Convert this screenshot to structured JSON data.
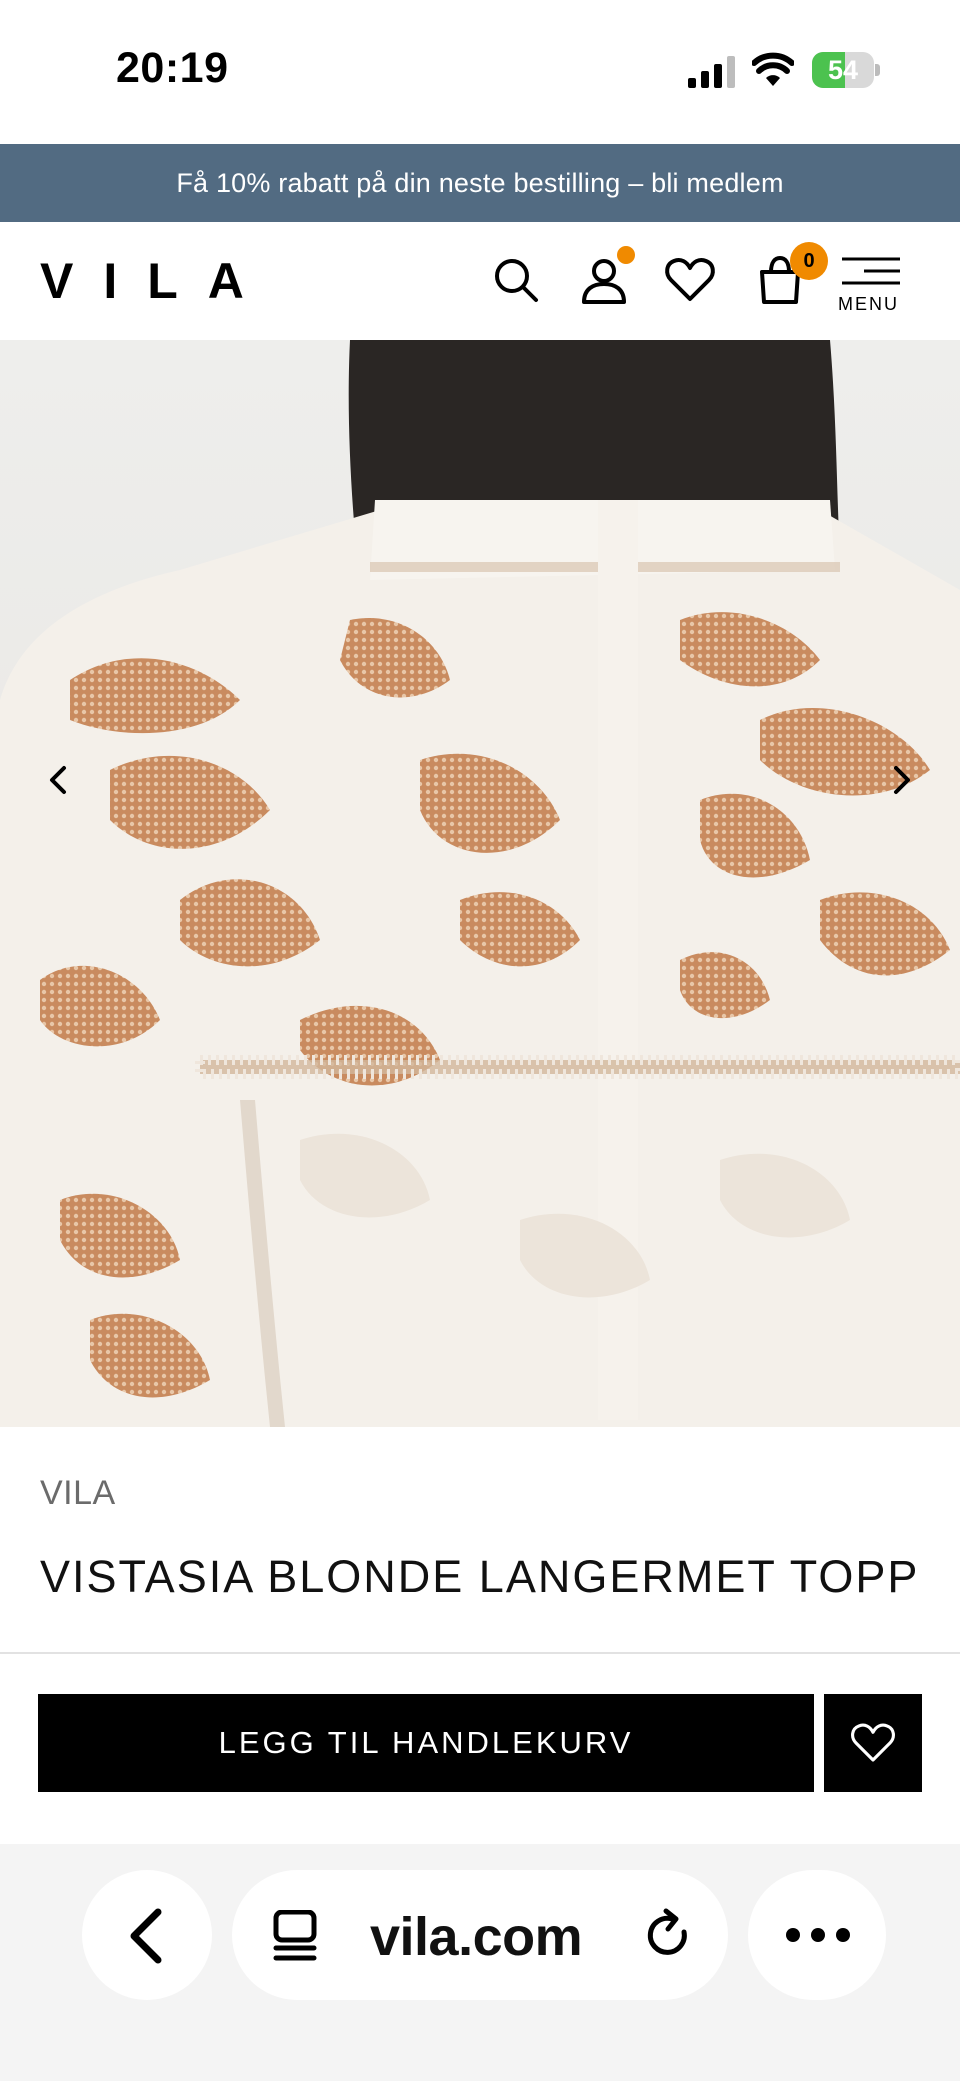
{
  "status_bar": {
    "time": "20:19",
    "battery_percent": "54",
    "battery_level": 0.54
  },
  "promo_banner": {
    "text": "Få 10% rabatt på din neste bestilling – bli medlem",
    "color": "#526b82"
  },
  "header": {
    "logo": "VILA",
    "cart_count": "0",
    "menu_label": "MENU",
    "badge_color": "#f08a00"
  },
  "product": {
    "brand": "VILA",
    "title": "VISTASIA BLONDE LANGERMET TOPP",
    "add_to_cart_label": "LEGG TIL HANDLEKURV"
  },
  "browser": {
    "url": "vila.com"
  },
  "icons": {
    "search": "search-icon",
    "account": "user-icon",
    "wishlist": "heart-icon",
    "cart": "bag-icon",
    "menu": "hamburger-icon",
    "prev": "chevron-left-icon",
    "next": "chevron-right-icon",
    "back": "back-icon",
    "tabs": "tabs-icon",
    "reload": "reload-icon",
    "more": "more-icon"
  }
}
